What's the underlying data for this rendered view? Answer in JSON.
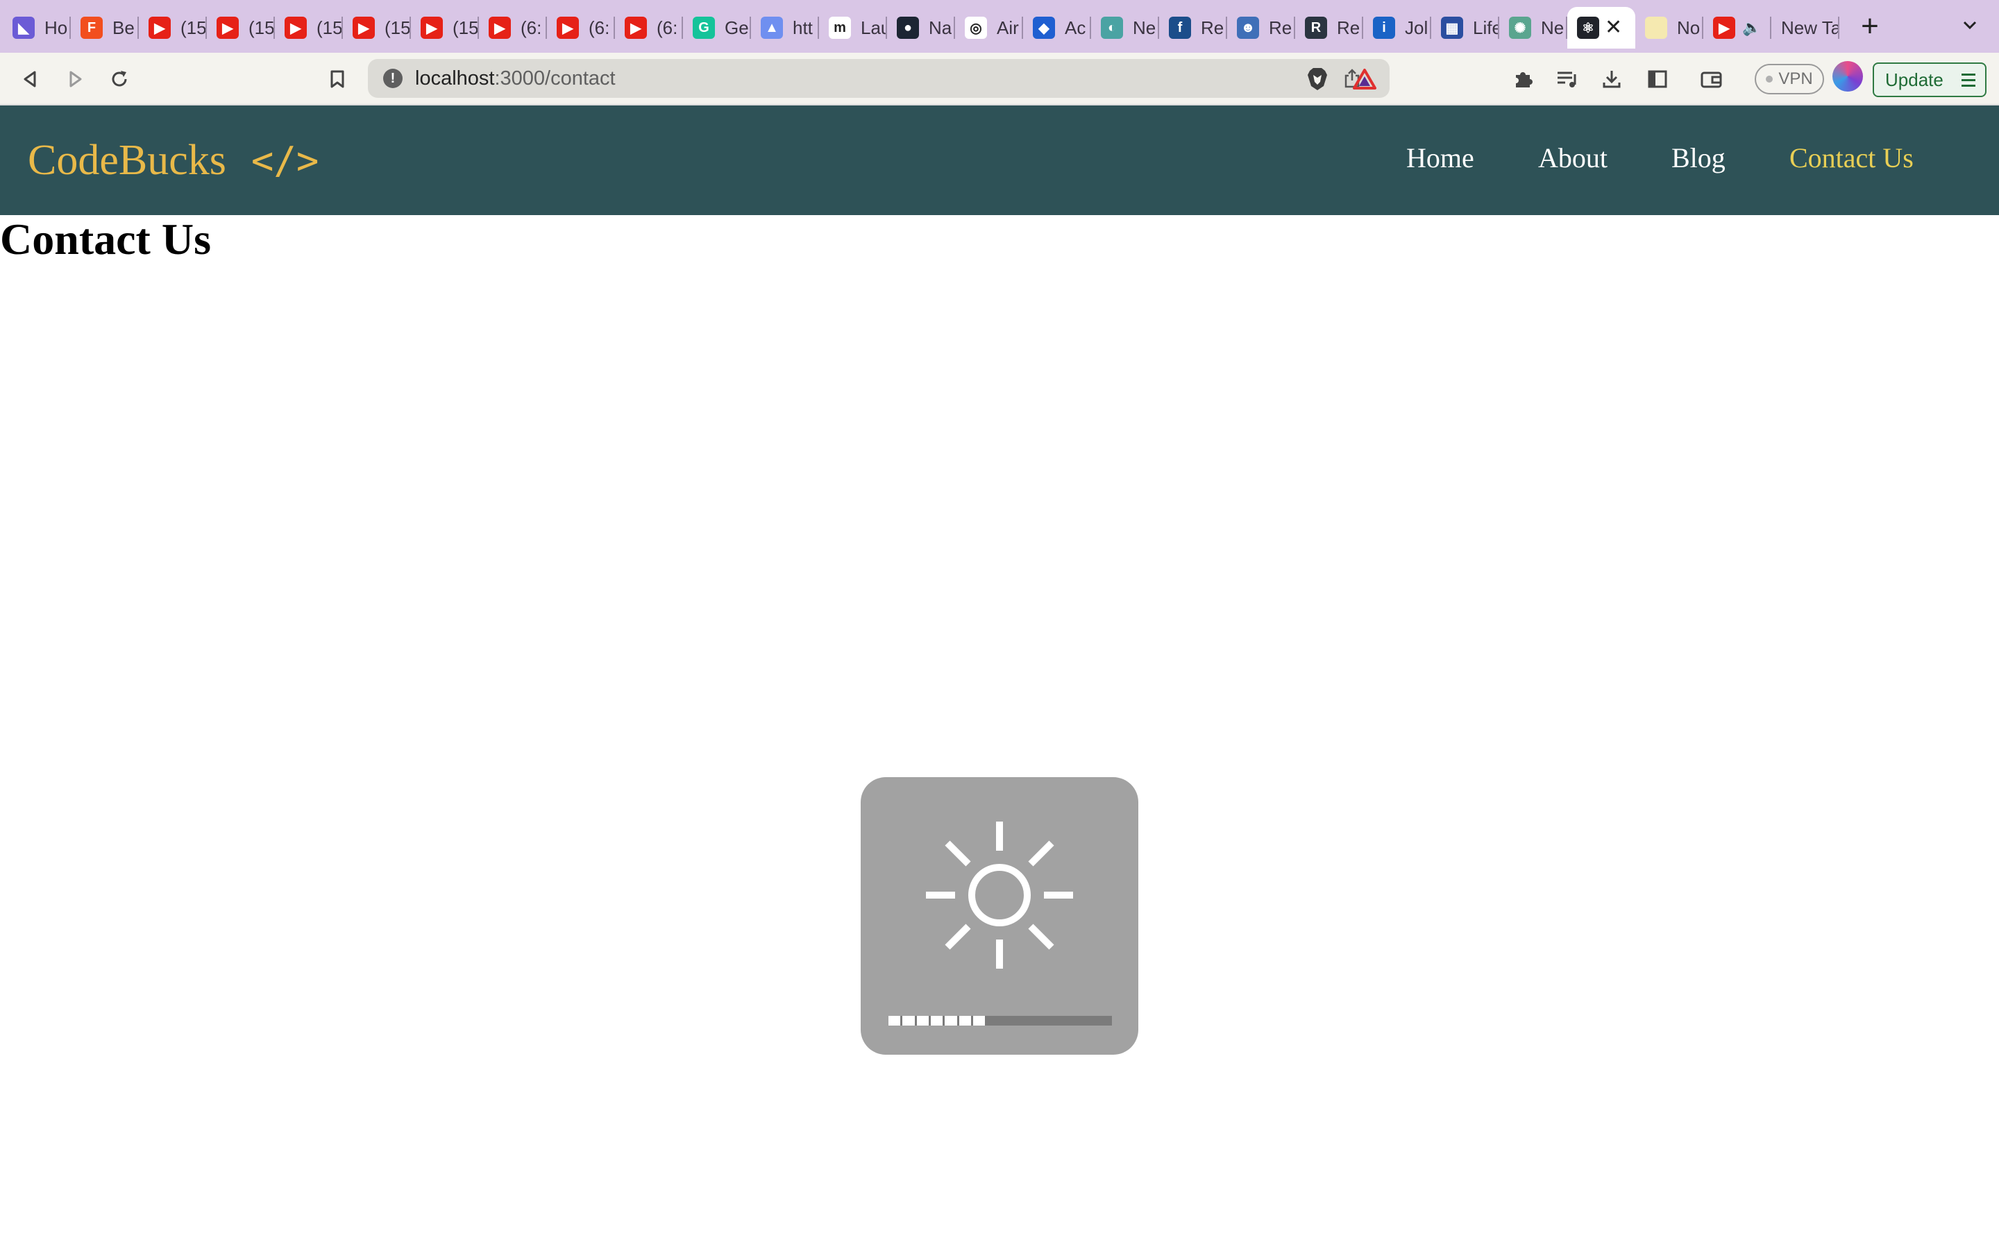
{
  "browser": {
    "tabs": [
      {
        "title": "Ho",
        "icon": "linear-icon",
        "color": "#6b5bd6",
        "glyph": "◣"
      },
      {
        "title": "Be",
        "icon": "figma-icon",
        "color": "#f24e1e",
        "glyph": "F"
      },
      {
        "title": "(15",
        "icon": "youtube-icon",
        "color": "#e62117",
        "glyph": "▶"
      },
      {
        "title": "(15",
        "icon": "youtube-icon",
        "color": "#e62117",
        "glyph": "▶"
      },
      {
        "title": "(15",
        "icon": "youtube-icon",
        "color": "#e62117",
        "glyph": "▶"
      },
      {
        "title": "(15",
        "icon": "youtube-icon",
        "color": "#e62117",
        "glyph": "▶"
      },
      {
        "title": "(15",
        "icon": "youtube-icon",
        "color": "#e62117",
        "glyph": "▶"
      },
      {
        "title": "(6:",
        "icon": "youtube-icon",
        "color": "#e62117",
        "glyph": "▶"
      },
      {
        "title": "(6:",
        "icon": "youtube-icon",
        "color": "#e62117",
        "glyph": "▶"
      },
      {
        "title": "(6:",
        "icon": "youtube-icon",
        "color": "#e62117",
        "glyph": "▶"
      },
      {
        "title": "Ge",
        "icon": "grammarly-icon",
        "color": "#15c39a",
        "glyph": "G"
      },
      {
        "title": "htt",
        "icon": "drive-icon",
        "color": "#6f8ff0",
        "glyph": "▲"
      },
      {
        "title": "Lau",
        "icon": "medium-icon",
        "color": "#ffffff",
        "glyph": "m"
      },
      {
        "title": "Na",
        "icon": "next-icon",
        "color": "#1c2533",
        "glyph": "●"
      },
      {
        "title": "Air",
        "icon": "airtable-icon",
        "color": "#ffffff",
        "glyph": "◎"
      },
      {
        "title": "Ac",
        "icon": "atlassian-icon",
        "color": "#1f5fd1",
        "glyph": "◆"
      },
      {
        "title": "Ne",
        "icon": "globe-icon",
        "color": "#4aa3a3",
        "glyph": "◐"
      },
      {
        "title": "Re",
        "icon": "facebook-icon",
        "color": "#1b4d8a",
        "glyph": "f"
      },
      {
        "title": "Re",
        "icon": "person-icon",
        "color": "#3f6fb8",
        "glyph": "☻"
      },
      {
        "title": "Re",
        "icon": "r-logo-icon",
        "color": "#2a3440",
        "glyph": "R"
      },
      {
        "title": "Jol",
        "icon": "info-icon",
        "color": "#1a63c6",
        "glyph": "i"
      },
      {
        "title": "Life",
        "icon": "life-icon",
        "color": "#2b4ea0",
        "glyph": "▦"
      },
      {
        "title": "Ne",
        "icon": "openai-icon",
        "color": "#5aa58f",
        "glyph": "✺"
      },
      {
        "title": "",
        "icon": "react-icon",
        "color": "#20232a",
        "glyph": "⚛"
      },
      {
        "title": "No",
        "icon": "note-icon",
        "color": "#f5e9b0",
        "glyph": ""
      },
      {
        "title": "",
        "icon": "youtube-icon",
        "color": "#e62117",
        "glyph": "▶"
      },
      {
        "title": "New Ta",
        "icon": "",
        "color": "",
        "glyph": ""
      }
    ],
    "active_tab_close": "✕",
    "new_tab": "+",
    "tab_search": "⌄",
    "url_host": "localhost",
    "url_rest": ":3000/contact",
    "vpn_label": "VPN",
    "update_label": "Update"
  },
  "site": {
    "brand": "CodeBucks",
    "brand_icon": "</>",
    "nav": [
      {
        "label": "Home",
        "active": false
      },
      {
        "label": "About",
        "active": false
      },
      {
        "label": "Blog",
        "active": false
      },
      {
        "label": "Contact Us",
        "active": true
      }
    ],
    "heading": "Contact Us"
  },
  "osd": {
    "type": "brightness",
    "level_segments": 7,
    "total_segments": 16
  },
  "colors": {
    "nav_bg": "#2e5257",
    "brand": "#e9b949",
    "nav_active": "#e9cf55",
    "tabstrip_bg": "#d9c6e6"
  }
}
